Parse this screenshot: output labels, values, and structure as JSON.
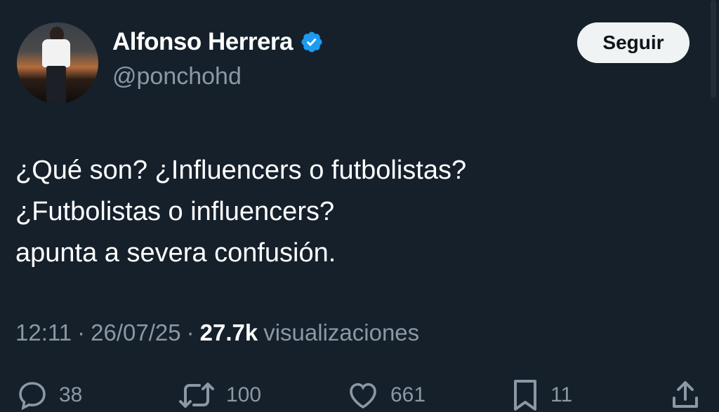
{
  "author": {
    "display_name": "Alfonso Herrera",
    "handle": "@ponchohd",
    "verified": true
  },
  "follow_button_label": "Seguir",
  "tweet": {
    "lines": [
      "¿Qué son? ¿Influencers o futbolistas?",
      "¿Futbolistas o influencers?",
      "apunta a severa confusión."
    ]
  },
  "meta": {
    "time": "12:11",
    "separator": "·",
    "date": "26/07/25",
    "views_count": "27.7k",
    "views_label": "visualizaciones"
  },
  "actions": {
    "replies": "38",
    "reposts": "100",
    "likes": "661",
    "bookmarks": "11"
  },
  "icons": {
    "verified": "verified-badge-icon",
    "reply": "reply-icon",
    "repost": "repost-icon",
    "like": "heart-icon",
    "bookmark": "bookmark-icon",
    "share": "share-icon"
  },
  "colors": {
    "background": "#15202b",
    "text_primary": "#ffffff",
    "text_secondary": "#8b98a5",
    "verified_blue": "#1d9bf0",
    "button_bg": "#eff3f4",
    "button_text": "#0f1419"
  }
}
